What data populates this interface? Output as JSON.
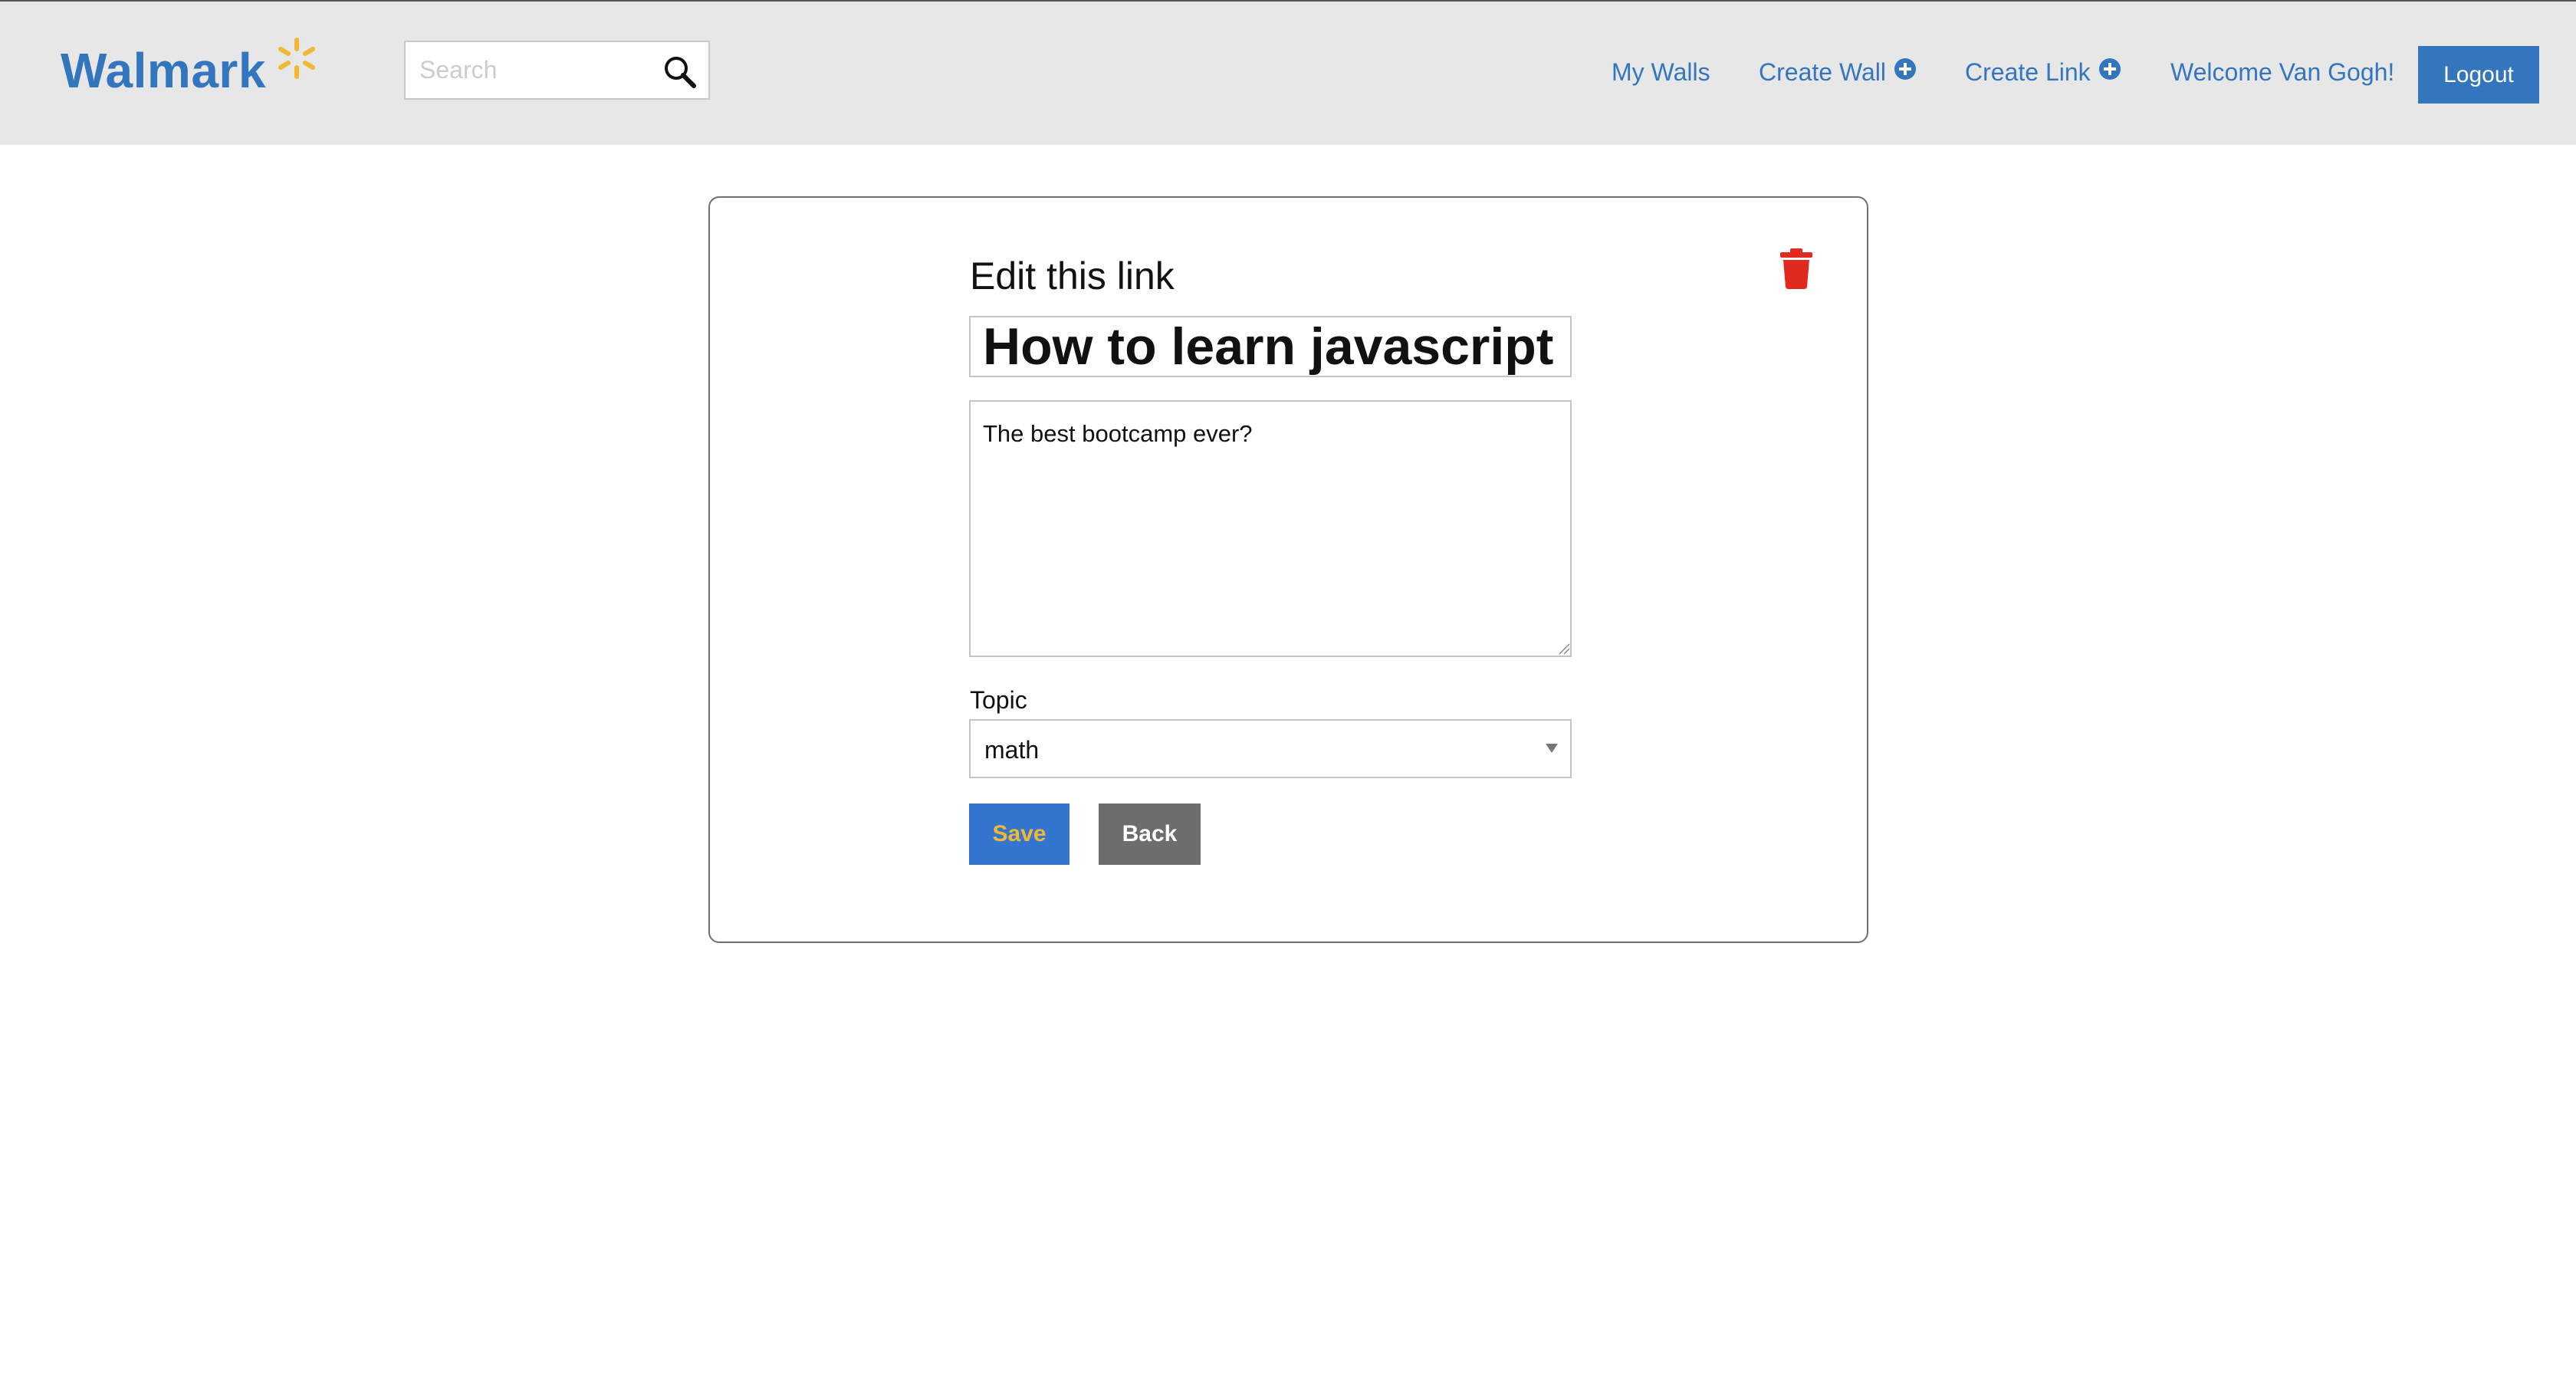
{
  "header": {
    "logo_text": "Walmark",
    "search": {
      "placeholder": "Search",
      "value": ""
    },
    "nav": {
      "my_walls": "My Walls",
      "create_wall": "Create Wall",
      "create_link": "Create Link",
      "welcome": "Welcome Van Gogh!"
    },
    "logout_label": "Logout"
  },
  "form": {
    "heading": "Edit this link",
    "title_value": "How to learn javascript",
    "description_value": "The best bootcamp ever?",
    "topic_label": "Topic",
    "topic_selected": "math",
    "save_label": "Save",
    "back_label": "Back"
  },
  "colors": {
    "brand_blue": "#3476be",
    "spark_yellow": "#f2b733",
    "delete_red": "#e0291f",
    "header_bg": "#e7e7e7"
  },
  "icons": {
    "logo_mark": "spark-icon",
    "search": "magnifier-icon",
    "add": "plus-circle-icon",
    "delete": "trash-icon"
  }
}
